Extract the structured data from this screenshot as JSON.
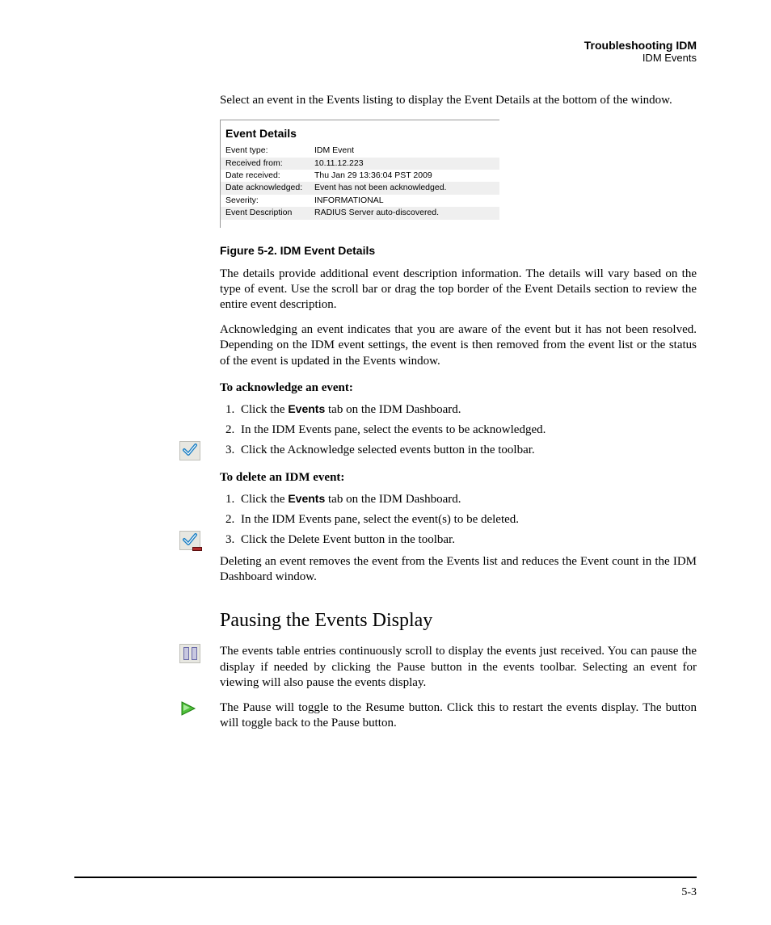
{
  "header": {
    "title": "Troubleshooting IDM",
    "subtitle": "IDM Events"
  },
  "intro": "Select an event in the Events listing to display the Event Details at the bottom of the window.",
  "event_details_panel": {
    "title": "Event Details",
    "rows": [
      {
        "label": "Event type:",
        "value": "IDM Event"
      },
      {
        "label": "Received from:",
        "value": "10.11.12.223"
      },
      {
        "label": "Date received:",
        "value": "Thu Jan 29 13:36:04 PST 2009"
      },
      {
        "label": "Date acknowledged:",
        "value": "Event has not been acknowledged."
      },
      {
        "label": "Severity:",
        "value": "INFORMATIONAL"
      },
      {
        "label": "Event Description",
        "value": "RADIUS Server auto-discovered."
      }
    ]
  },
  "figure_caption": "Figure 5-2. IDM Event Details",
  "details_para": "The details provide additional event description information. The details will vary based on the type of event. Use the scroll bar or drag the top border of the Event Details section to review the entire event description.",
  "ack_para": "Acknowledging an event indicates that you are aware of the event but it has not been resolved. Depending on the IDM event settings, the event is then removed from the event list or the status of the event is updated in the Events window.",
  "ack_head": "To acknowledge an event:",
  "ack_steps": {
    "s1a": "Click the ",
    "s1b": "Events",
    "s1c": " tab on the IDM Dashboard.",
    "s2": "In the IDM Events pane, select the events to be acknowledged.",
    "s3": "Click the Acknowledge selected events button in the toolbar."
  },
  "del_head": "To delete an IDM event:",
  "del_steps": {
    "s1a": "Click the ",
    "s1b": "Events",
    "s1c": " tab on the IDM Dashboard.",
    "s2": "In the IDM Events pane, select the event(s) to be deleted.",
    "s3": "Click the Delete Event button in the toolbar."
  },
  "del_note": "Deleting an event removes the event from the Events list and reduces the Event count in the IDM Dashboard window.",
  "section_title": "Pausing the Events Display",
  "pause_para": "The events table entries continuously scroll to display the events just received. You can pause the display if needed by clicking the Pause button in the events toolbar. Selecting an event for viewing will also pause the events display.",
  "resume_para": "The Pause will toggle to the Resume button. Click this to restart the events display. The button will toggle back to the Pause button.",
  "page_number": "5-3"
}
